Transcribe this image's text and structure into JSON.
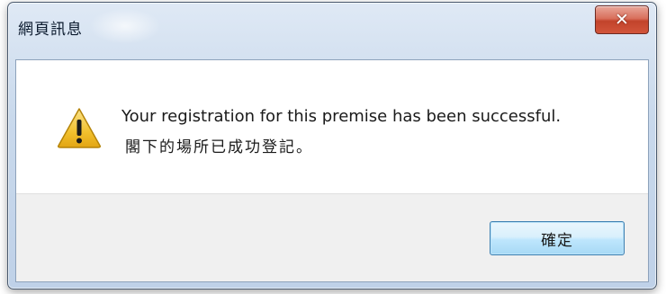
{
  "window": {
    "title": "網頁訊息",
    "close_icon": "✕"
  },
  "message": {
    "line1": "Your registration for this premise has been successful.",
    "line2": "閣下的場所已成功登記。",
    "icon": "warning-icon"
  },
  "buttons": {
    "ok_label": "確定"
  },
  "colors": {
    "titlebar": "#c9d9ec",
    "close_button": "#c2432b",
    "warning_yellow": "#f2c12e",
    "ok_button_border": "#3c7fb1"
  }
}
